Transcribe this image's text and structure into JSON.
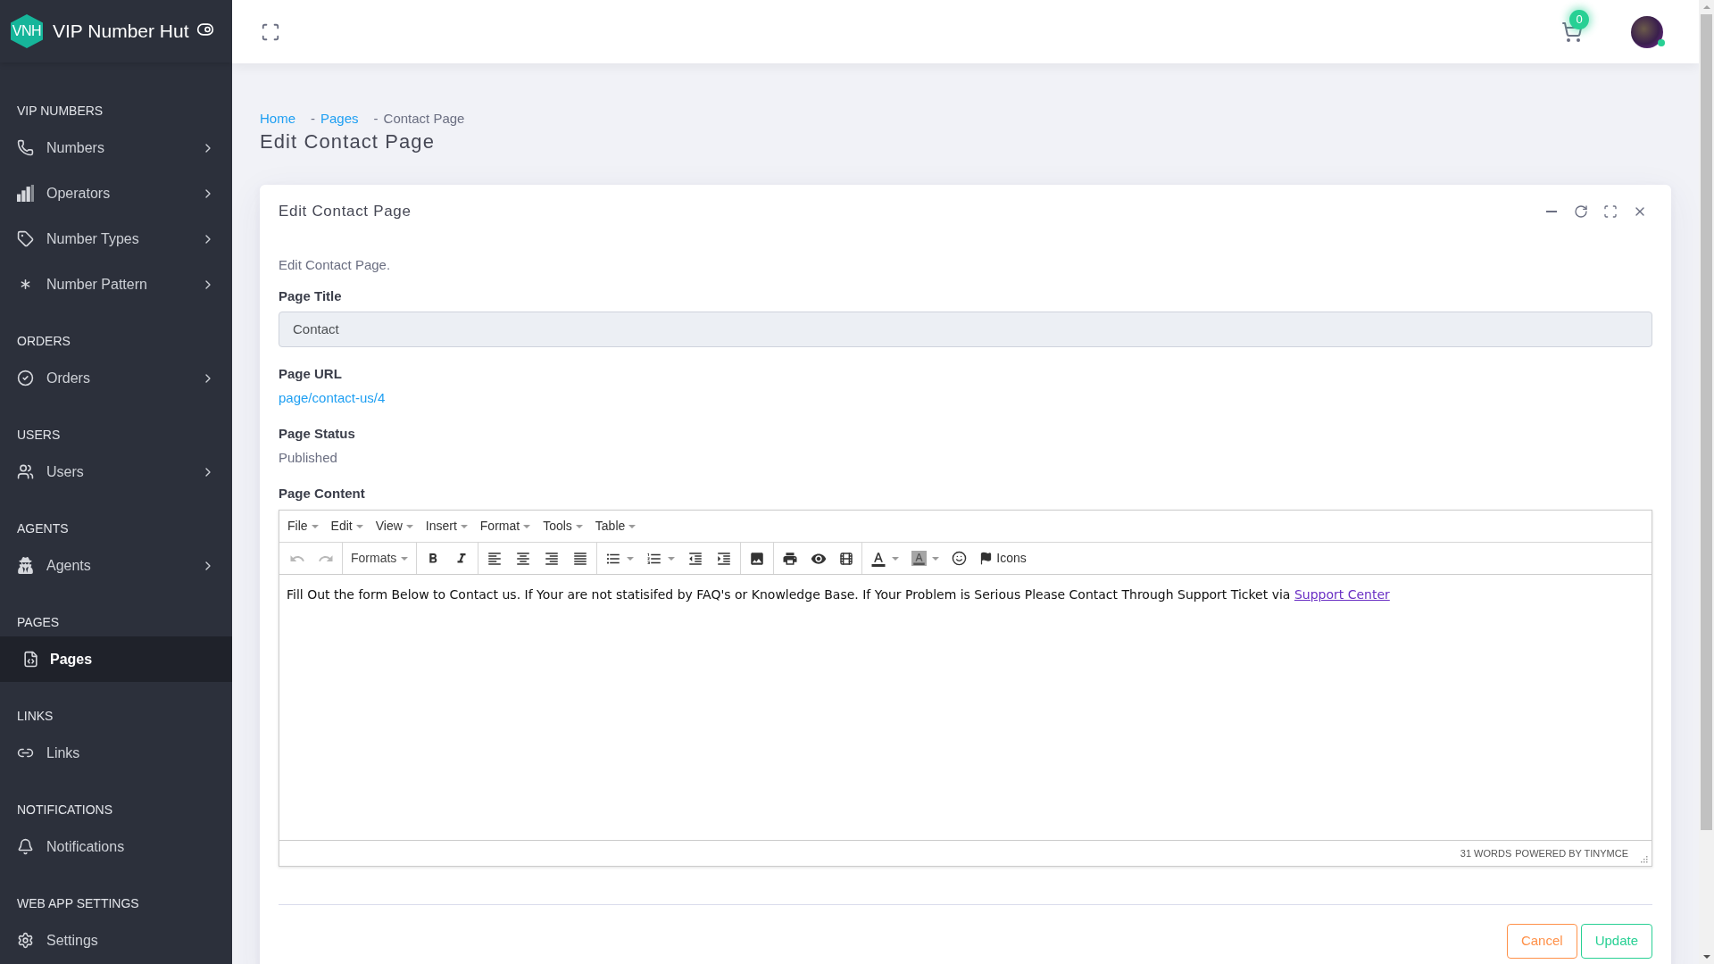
{
  "brand": {
    "logo": "VNH",
    "name": "VIP Number Hut"
  },
  "sidebar": {
    "sections": [
      {
        "title": "VIP NUMBERS",
        "items": [
          {
            "label": "Numbers",
            "submenu": true,
            "selected": false
          },
          {
            "label": "Operators",
            "submenu": true,
            "selected": false
          },
          {
            "label": "Number Types",
            "submenu": true,
            "selected": false
          },
          {
            "label": "Number Pattern",
            "submenu": true,
            "selected": false
          }
        ]
      },
      {
        "title": "ORDERS",
        "items": [
          {
            "label": "Orders",
            "submenu": true,
            "selected": false
          }
        ]
      },
      {
        "title": "USERS",
        "items": [
          {
            "label": "Users",
            "submenu": true,
            "selected": false
          }
        ]
      },
      {
        "title": "AGENTS",
        "items": [
          {
            "label": "Agents",
            "submenu": true,
            "selected": false
          }
        ]
      },
      {
        "title": "PAGES",
        "items": [
          {
            "label": "Pages",
            "submenu": false,
            "selected": true
          }
        ]
      },
      {
        "title": "LINKS",
        "items": [
          {
            "label": "Links",
            "submenu": false,
            "selected": false
          }
        ]
      },
      {
        "title": "NOTIFICATIONS",
        "items": [
          {
            "label": "Notifications",
            "submenu": false,
            "selected": false
          }
        ]
      },
      {
        "title": "WEB APP SETTINGS",
        "items": [
          {
            "label": "Settings",
            "submenu": false,
            "selected": false
          }
        ]
      }
    ]
  },
  "topbar": {
    "cart_count": "0",
    "user_online": true
  },
  "breadcrumb": [
    {
      "kind": "link",
      "label": "Home"
    },
    {
      "kind": "link",
      "separator": "-",
      "label": "Pages"
    },
    {
      "kind": "current",
      "separator": "-",
      "label": "Contact Page"
    }
  ],
  "page_title": "Edit Contact Page",
  "card": {
    "title": "Edit Contact Page",
    "description": "Edit Contact Page.",
    "fields": [
      {
        "kind": "input",
        "label": "Page Title",
        "value": "Contact"
      },
      {
        "kind": "link",
        "label": "Page URL",
        "value": "page/contact-us/4"
      },
      {
        "kind": "text",
        "label": "Page Status",
        "value": "Published"
      },
      {
        "kind": "editor",
        "label": "Page Content",
        "editor": {
          "menu": [
            "File",
            "Edit",
            "View",
            "Insert",
            "Format",
            "Tools",
            "Table"
          ],
          "toolbar": {
            "undo": {
              "disabled": true
            },
            "redo": {
              "disabled": true
            },
            "formats": "Formats",
            "icons": "Icons"
          },
          "content": {
            "text": "Fill Out the form Below to Contact us. If Your are not statisifed by FAQ's or Knowledge Base. If Your Problem is Serious Please Contact Through Support Ticket via",
            "link": "Support Center"
          },
          "word_count": "31 WORDS",
          "branding": "POWERED BY TINYMCE"
        }
      }
    ],
    "buttons": [
      {
        "kind": "cancel",
        "label": "Cancel"
      },
      {
        "kind": "submit",
        "label": "Update"
      }
    ]
  }
}
